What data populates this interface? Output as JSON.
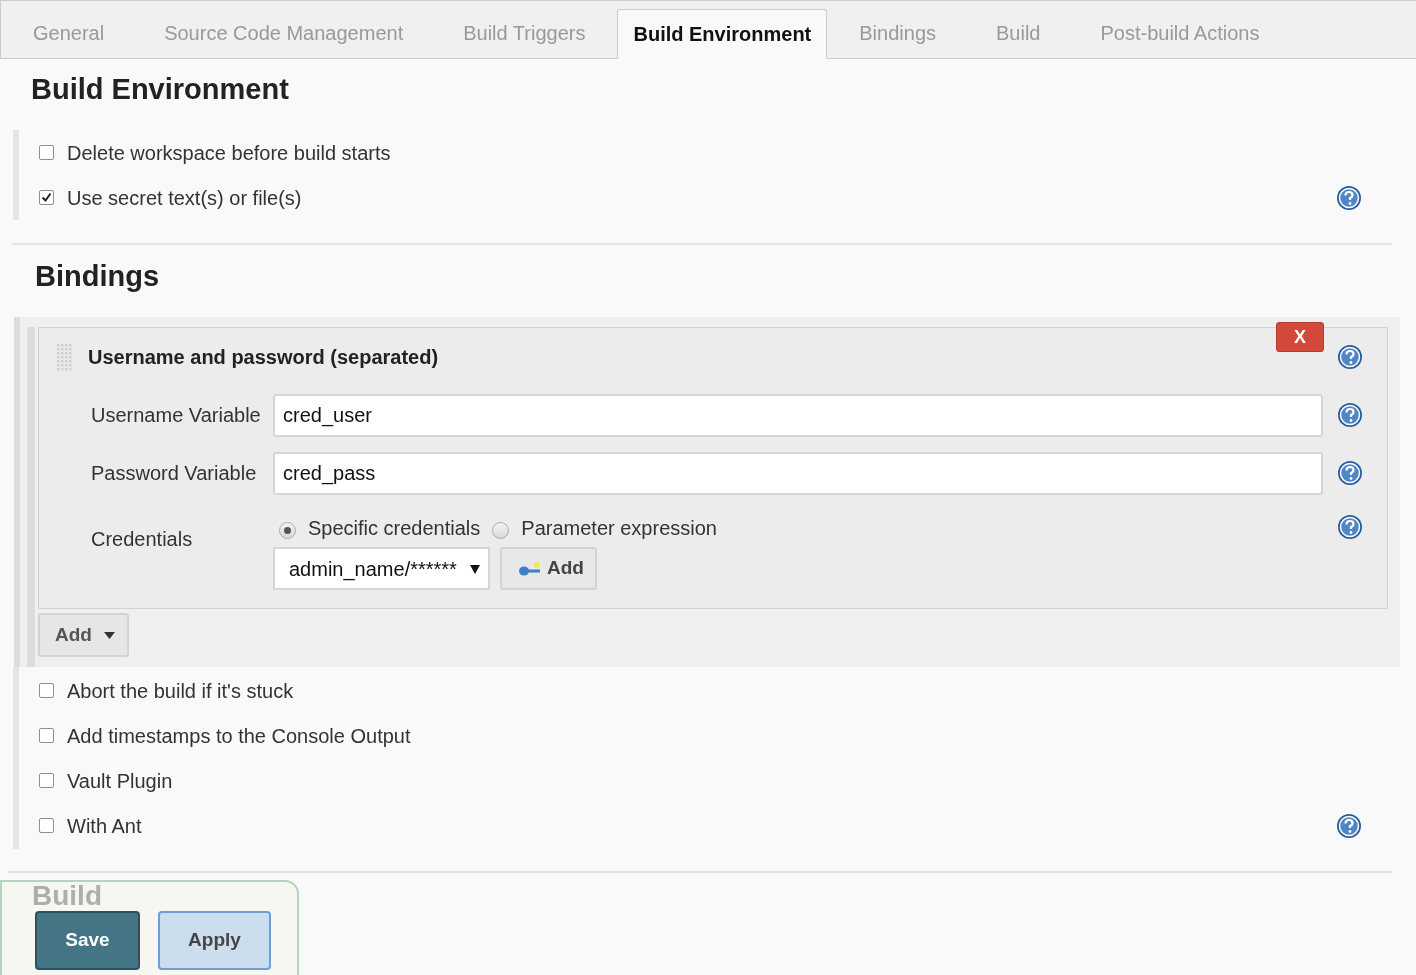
{
  "tabs": [
    {
      "label": "General",
      "selected": false
    },
    {
      "label": "Source Code Management",
      "selected": false
    },
    {
      "label": "Build Triggers",
      "selected": false
    },
    {
      "label": "Build Environment",
      "selected": true
    },
    {
      "label": "Bindings",
      "selected": false
    },
    {
      "label": "Build",
      "selected": false
    },
    {
      "label": "Post-build Actions",
      "selected": false
    }
  ],
  "build_environment": {
    "title": "Build Environment",
    "options": [
      {
        "label": "Delete workspace before build starts",
        "checked": false,
        "help": false
      },
      {
        "label": "Use secret text(s) or file(s)",
        "checked": true,
        "help": true
      }
    ]
  },
  "bindings": {
    "title": "Bindings",
    "binding": {
      "title": "Username and password (separated)",
      "delete_label": "X",
      "fields": [
        {
          "label": "Username Variable",
          "value": "cred_user"
        },
        {
          "label": "Password Variable",
          "value": "cred_pass"
        }
      ],
      "credentials": {
        "label": "Credentials",
        "options": [
          {
            "label": "Specific credentials",
            "selected": true
          },
          {
            "label": "Parameter expression",
            "selected": false
          }
        ],
        "select_value": "admin_name/******",
        "add_label": "Add"
      }
    },
    "add_label": "Add"
  },
  "more_options": [
    {
      "label": "Abort the build if it's stuck",
      "checked": false,
      "help": false
    },
    {
      "label": "Add timestamps to the Console Output",
      "checked": false,
      "help": false
    },
    {
      "label": "Vault Plugin",
      "checked": false,
      "help": false
    },
    {
      "label": "With Ant",
      "checked": false,
      "help": true
    }
  ],
  "build_section": {
    "title": "Build"
  },
  "actions": [
    {
      "label": "Save",
      "kind": "primary"
    },
    {
      "label": "Apply",
      "kind": "secondary"
    }
  ]
}
